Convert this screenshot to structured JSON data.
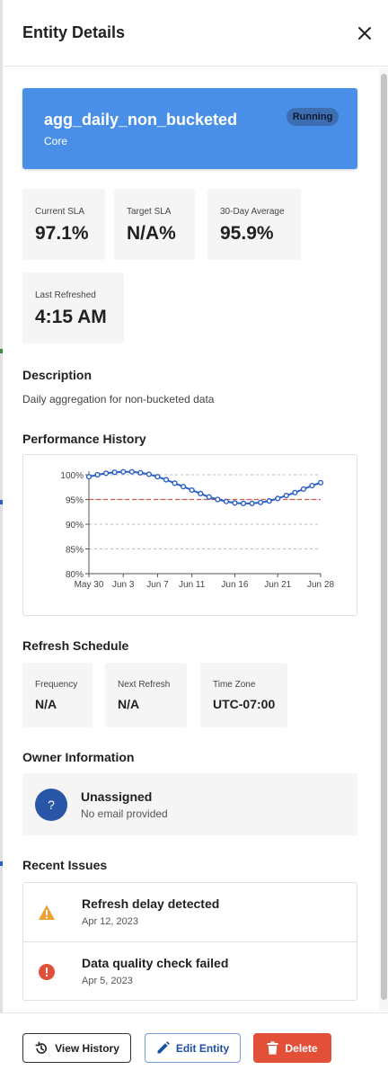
{
  "header": {
    "title": "Entity Details"
  },
  "entity": {
    "name": "agg_daily_non_bucketed",
    "group": "Core",
    "status": "Running",
    "accent_color": "#4a8fe7"
  },
  "stats": [
    {
      "label": "Current SLA",
      "value": "97.1%"
    },
    {
      "label": "Target SLA",
      "value": "N/A%"
    },
    {
      "label": "30-Day Average",
      "value": "95.9%"
    },
    {
      "label": "Last Refreshed",
      "value": "4:15 AM"
    }
  ],
  "description": {
    "title": "Description",
    "text": "Daily aggregation for non-bucketed data"
  },
  "performance": {
    "title": "Performance History"
  },
  "chart_data": {
    "type": "line",
    "x_tick_labels": [
      "May 30",
      "Jun 3",
      "Jun 7",
      "Jun 11",
      "Jun 16",
      "Jun 21",
      "Jun 28"
    ],
    "y_tick_labels": [
      "100%",
      "95%",
      "90%",
      "85%",
      "80%"
    ],
    "ylim": [
      80,
      100
    ],
    "target_line": 95,
    "grid": true,
    "series_color": "#2a5fc4",
    "target_color": "#e05a4a",
    "points": [
      {
        "x": 0,
        "y": 99.6
      },
      {
        "x": 1,
        "y": 100.0
      },
      {
        "x": 2,
        "y": 100.3
      },
      {
        "x": 3,
        "y": 100.5
      },
      {
        "x": 4,
        "y": 100.6
      },
      {
        "x": 5,
        "y": 100.6
      },
      {
        "x": 6,
        "y": 100.4
      },
      {
        "x": 7,
        "y": 100.1
      },
      {
        "x": 8,
        "y": 99.6
      },
      {
        "x": 9,
        "y": 99.0
      },
      {
        "x": 10,
        "y": 98.3
      },
      {
        "x": 11,
        "y": 97.6
      },
      {
        "x": 12,
        "y": 96.9
      },
      {
        "x": 13,
        "y": 96.2
      },
      {
        "x": 14,
        "y": 95.5
      },
      {
        "x": 15,
        "y": 95.0
      },
      {
        "x": 16,
        "y": 94.6
      },
      {
        "x": 17,
        "y": 94.3
      },
      {
        "x": 18,
        "y": 94.2
      },
      {
        "x": 19,
        "y": 94.2
      },
      {
        "x": 20,
        "y": 94.4
      },
      {
        "x": 21,
        "y": 94.7
      },
      {
        "x": 22,
        "y": 95.2
      },
      {
        "x": 23,
        "y": 95.8
      },
      {
        "x": 24,
        "y": 96.4
      },
      {
        "x": 25,
        "y": 97.1
      },
      {
        "x": 26,
        "y": 97.8
      },
      {
        "x": 27,
        "y": 98.4
      }
    ]
  },
  "schedule": {
    "title": "Refresh Schedule",
    "items": [
      {
        "label": "Frequency",
        "value": "N/A"
      },
      {
        "label": "Next Refresh",
        "value": "N/A"
      },
      {
        "label": "Time Zone",
        "value": "UTC-07:00"
      }
    ]
  },
  "owner": {
    "title": "Owner Information",
    "avatar": "?",
    "name": "Unassigned",
    "email": "No email provided"
  },
  "issues": {
    "title": "Recent Issues",
    "items": [
      {
        "title": "Refresh delay detected",
        "date": "Apr 12, 2023",
        "icon": "warning-icon",
        "color": "#f0a030"
      },
      {
        "title": "Data quality check failed",
        "date": "Apr 5, 2023",
        "icon": "error-icon",
        "color": "#e2503a"
      }
    ]
  },
  "footer": {
    "history_label": "View History",
    "edit_label": "Edit Entity",
    "delete_label": "Delete"
  }
}
